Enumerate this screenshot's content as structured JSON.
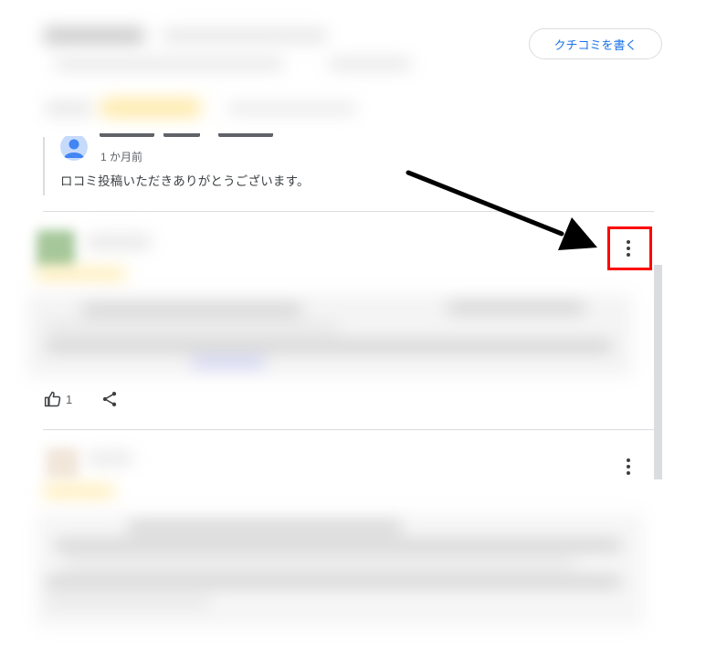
{
  "header": {
    "write_review_label": "クチコミを書く"
  },
  "owner_reply": {
    "time": "1 か月前",
    "text": "ロコミ投稿いただきありがとうございます。"
  },
  "review": {
    "like_count": "1"
  },
  "icons": {
    "more": "more-vert-icon",
    "like": "thumb-up-icon",
    "share": "share-icon",
    "avatar": "person-avatar-icon",
    "annotation": "arrow-annotation"
  },
  "colors": {
    "accent": "#1a73e8",
    "highlight": "#ff0000",
    "divider": "#dadce0"
  }
}
